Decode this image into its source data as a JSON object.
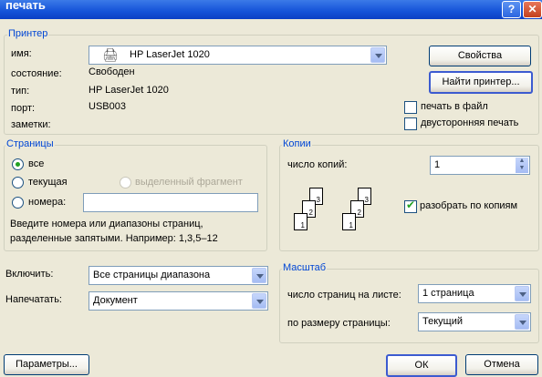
{
  "window": {
    "title": "печать"
  },
  "printer": {
    "legend": "Принтер",
    "name_label": "имя:",
    "name_value": "HP LaserJet 1020",
    "status_label": "состояние:",
    "status_value": "Свободен",
    "type_label": "тип:",
    "type_value": "HP LaserJet 1020",
    "port_label": "порт:",
    "port_value": "USB003",
    "notes_label": "заметки:",
    "properties_button": "Свойства",
    "find_printer_button": "Найти принтер...",
    "print_to_file": {
      "label": "печать в файл",
      "checked": false
    },
    "duplex": {
      "label": "двусторонняя печать",
      "checked": false
    }
  },
  "pages": {
    "legend": "Страницы",
    "all": {
      "label": "все",
      "selected": true
    },
    "current": {
      "label": "текущая",
      "selected": false
    },
    "selection": {
      "label": "выделенный фрагмент",
      "disabled": true
    },
    "numbers": {
      "label": "номера:",
      "value": ""
    },
    "hint_line1": "Введите номера или диапазоны страниц,",
    "hint_line2": "разделенные запятыми. Например: 1,3,5–12"
  },
  "copies": {
    "legend": "Копии",
    "count_label": "число копий:",
    "count_value": "1",
    "collate": {
      "label": "разобрать по копиям",
      "checked": true
    },
    "page_numbers": [
      "1",
      "2",
      "3"
    ]
  },
  "include": {
    "label": "Включить:",
    "value": "Все страницы диапазона"
  },
  "print_what": {
    "label": "Напечатать:",
    "value": "Документ"
  },
  "zoom": {
    "legend": "Масштаб",
    "pages_per_sheet_label": "число страниц на листе:",
    "pages_per_sheet_value": "1 страница",
    "scale_label": "по размеру страницы:",
    "scale_value": "Текущий"
  },
  "footer": {
    "options_button": "Параметры...",
    "ok_button": "ОК",
    "cancel_button": "Отмена"
  },
  "colors": {
    "title_blue": "#1452d8",
    "legend_blue": "#0046d5",
    "dialog_bg": "#ece9d8"
  }
}
